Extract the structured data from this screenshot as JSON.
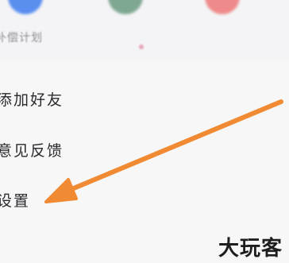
{
  "top_row": {
    "items": [
      {
        "label": "补偿计划"
      },
      {
        "label": ""
      },
      {
        "label": ""
      }
    ]
  },
  "menu": {
    "items": [
      {
        "label": "添加好友"
      },
      {
        "label": "意见反馈"
      },
      {
        "label": "设置"
      }
    ]
  },
  "watermark": "大玩客",
  "colors": {
    "arrow": "#f08a33",
    "icon_blue": "#5a8ff0",
    "icon_green": "#7fa892",
    "icon_red": "#ef8a8a"
  }
}
